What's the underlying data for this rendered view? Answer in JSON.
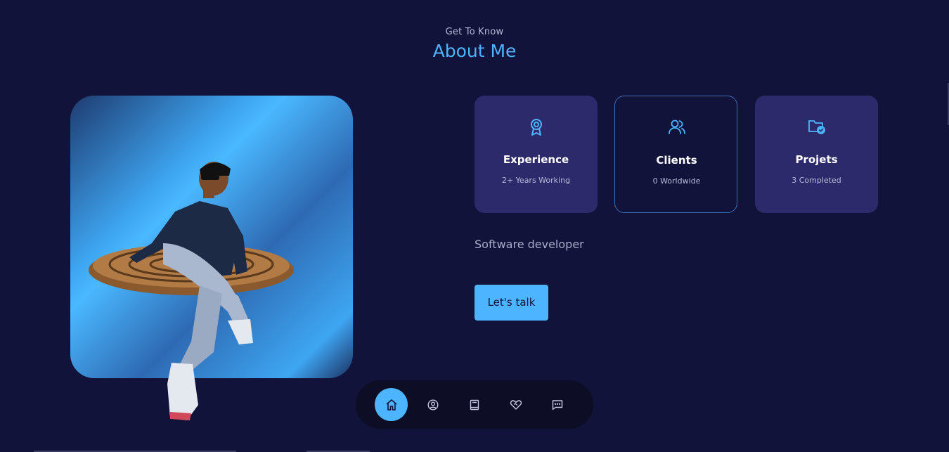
{
  "header": {
    "kicker": "Get To Know",
    "title": "About Me"
  },
  "cards": [
    {
      "label": "Experience",
      "sub": "2+ Years Working",
      "icon": "award-icon"
    },
    {
      "label": "Clients",
      "sub": "0 Worldwide",
      "icon": "users-icon"
    },
    {
      "label": "Projets",
      "sub": "3 Completed",
      "icon": "folder-check-icon"
    }
  ],
  "bio": "Software developer",
  "cta_label": "Let's talk",
  "nav": [
    {
      "name": "home",
      "icon": "home-icon",
      "active": true
    },
    {
      "name": "about",
      "icon": "user-circle-icon",
      "active": false
    },
    {
      "name": "experience",
      "icon": "book-icon",
      "active": false
    },
    {
      "name": "services",
      "icon": "heart-handshake-icon",
      "active": false
    },
    {
      "name": "contact",
      "icon": "message-icon",
      "active": false
    }
  ],
  "colors": {
    "background": "#12133a",
    "accent": "#4db5ff",
    "card": "#2c2a6b",
    "card_border": "#3b6fb3",
    "dock": "#0d0e25"
  }
}
